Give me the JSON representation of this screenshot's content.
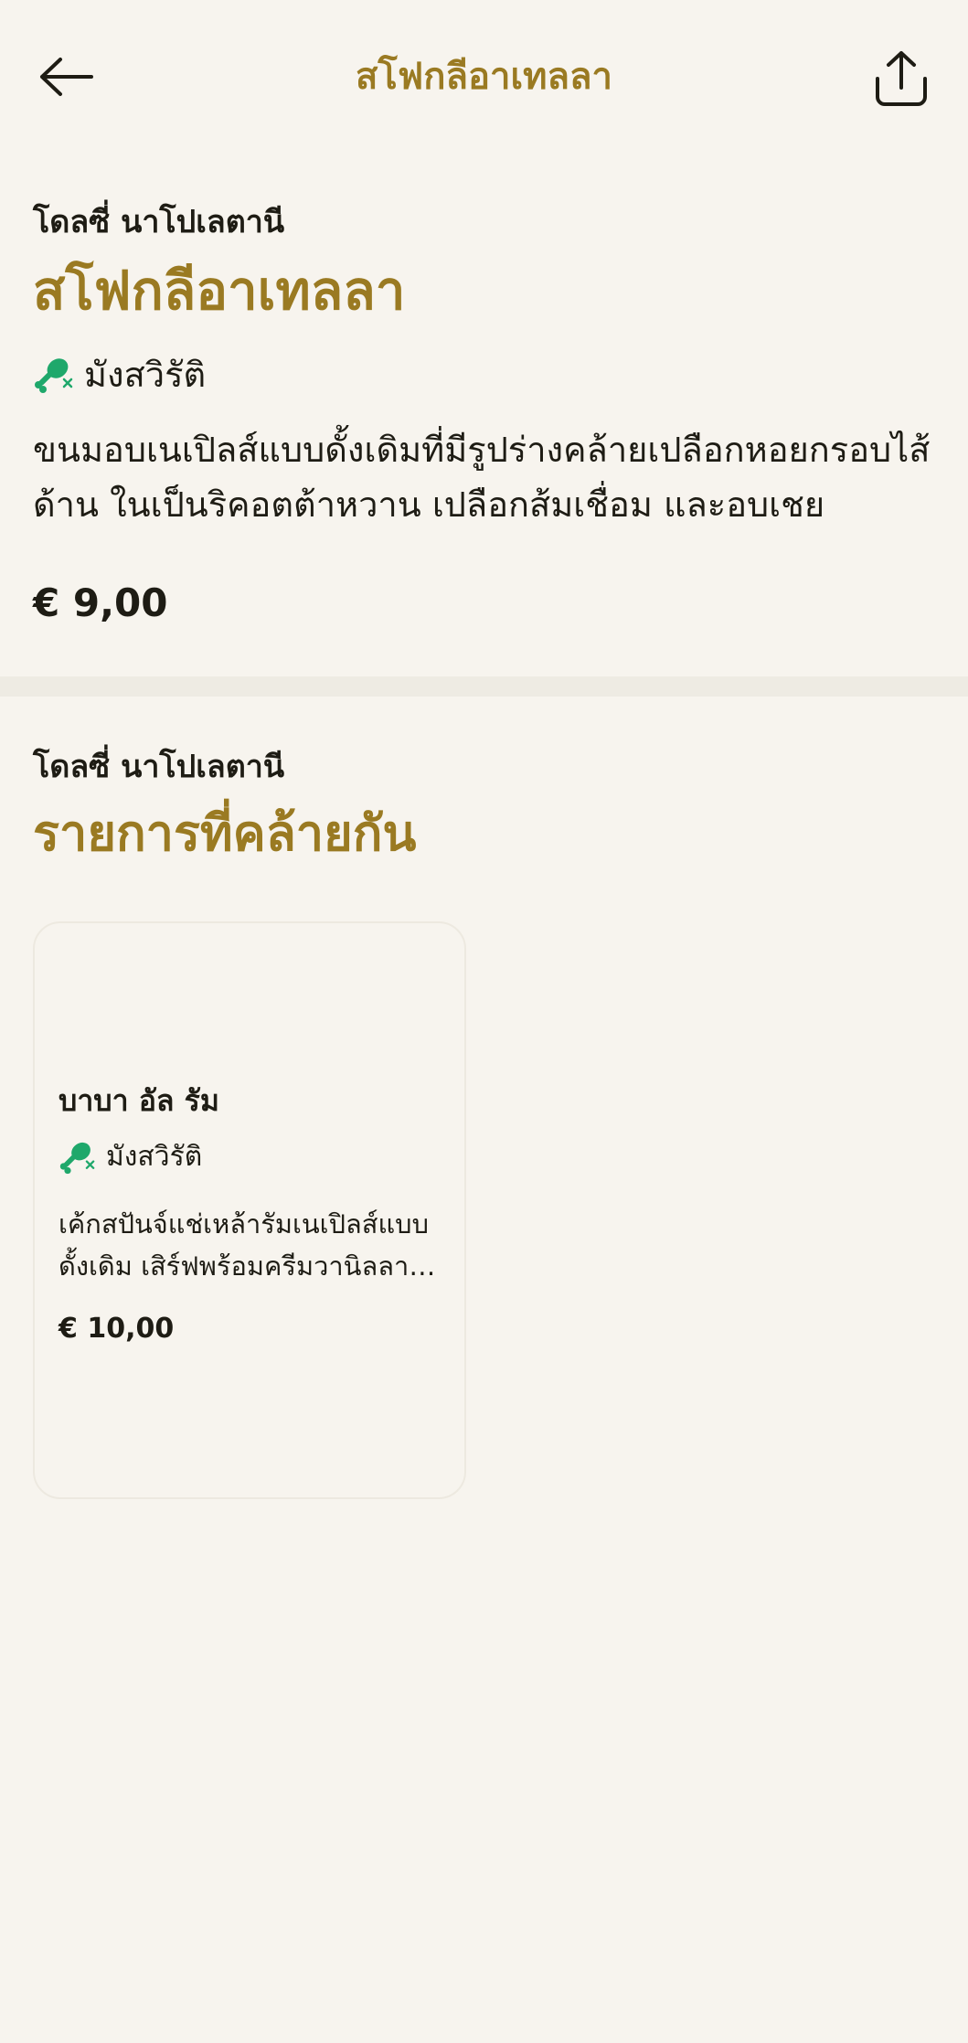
{
  "header": {
    "title": "สโฟกลีอาเทลลา",
    "back_icon": "arrow-left-icon",
    "share_icon": "share-icon"
  },
  "product": {
    "restaurant": "โดลซี่ นาโปเลตานี",
    "title": "สโฟกลีอาเทลลา",
    "tag": "มังสวิรัติ",
    "tag_icon": "vegetarian-drumstick-icon",
    "description": "ขนมอบเนเปิลส์แบบดั้งเดิมที่มีรูปร่างคล้ายเปลือกหอยกรอบไส้ด้าน ในเป็นริคอตต้าหวาน เปลือกส้มเชื่อม และอบเชย",
    "price": "€ 9,00"
  },
  "similar": {
    "restaurant": "โดลซี่ นาโปเลตานี",
    "heading": "รายการที่คล้ายกัน",
    "items": [
      {
        "title": "บาบา อัล รัม",
        "tag": "มังสวิรัติ",
        "description": "เค้กสปันจ์แช่เหล้ารัมเนเปิลส์แบบดั้งเดิม เสิร์ฟพร้อมครีมวานิลลาและ",
        "price": "€ 10,00"
      }
    ]
  },
  "colors": {
    "background": "#F7F4EE",
    "accent": "#9A7A22",
    "text": "#1E1C14",
    "veg_green": "#1FA86B",
    "divider": "#EEEBE3"
  }
}
